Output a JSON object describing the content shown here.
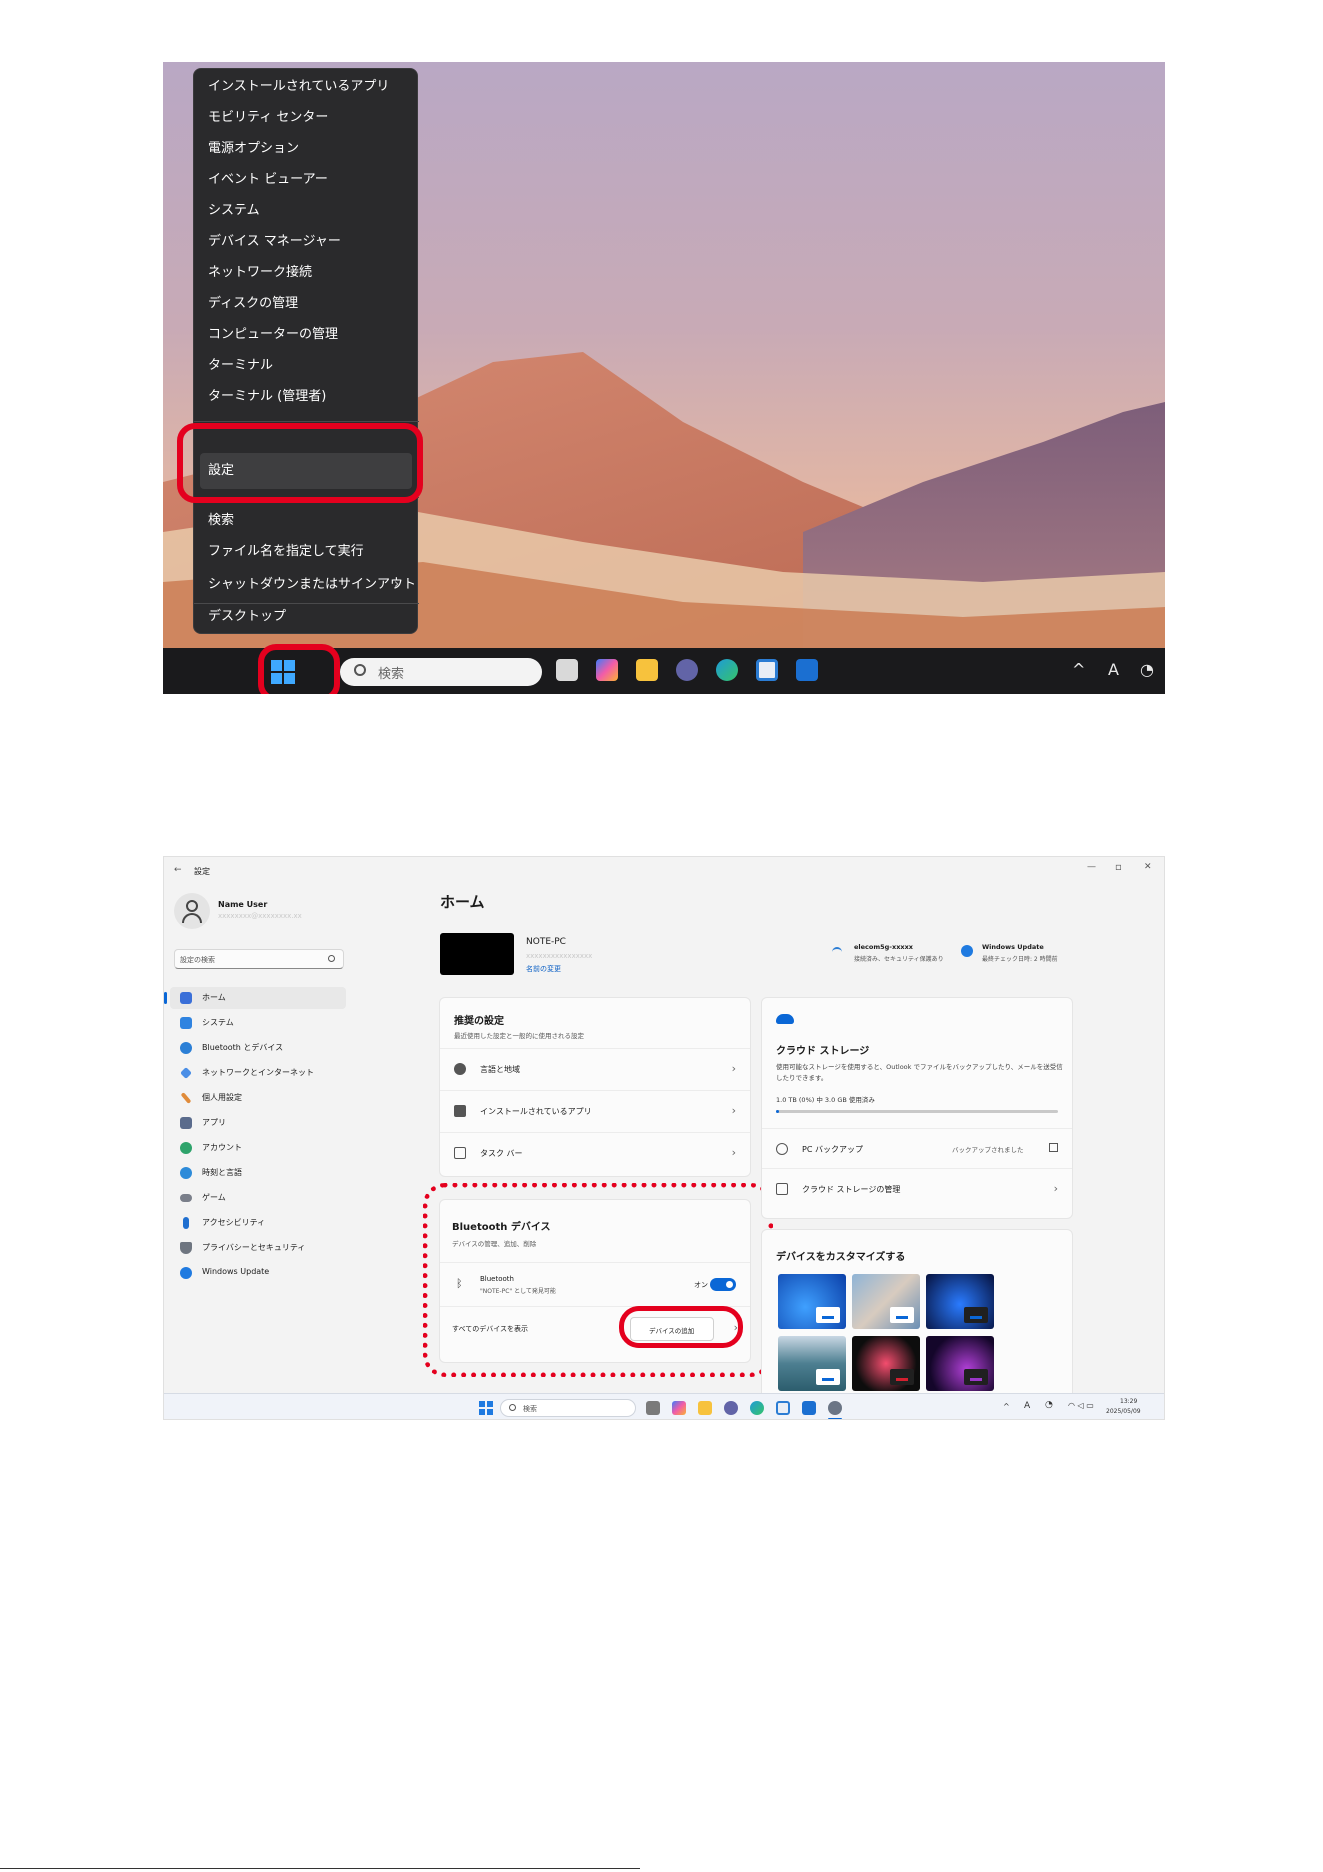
{
  "shot1": {
    "context_menu": {
      "items": [
        "インストールされているアプリ",
        "モビリティ センター",
        "電源オプション",
        "イベント ビューアー",
        "システム",
        "デバイス マネージャー",
        "ネットワーク接続",
        "ディスクの管理",
        "コンピューターの管理",
        "ターミナル",
        "ターミナル (管理者)",
        "設定",
        "検索",
        "ファイル名を指定して実行",
        "シャットダウンまたはサインアウト",
        "デスクトップ"
      ],
      "submenu_arrow": "›"
    },
    "taskbar": {
      "search_placeholder": "検索",
      "tray_up": "^",
      "tray_ime": "A",
      "tray_power": "◔"
    }
  },
  "shot2": {
    "window": {
      "back": "←",
      "title": "設定",
      "min": "—",
      "max": "▫",
      "close": "✕"
    },
    "user": {
      "name": "Name User",
      "email": "xxxxxxxx@xxxxxxxx.xx"
    },
    "search_placeholder": "設定の検索",
    "nav": [
      {
        "label": "ホーム",
        "color": "#3a6fd8"
      },
      {
        "label": "システム",
        "color": "#2f83e0"
      },
      {
        "label": "Bluetooth とデバイス",
        "color": "#2b7fd6"
      },
      {
        "label": "ネットワークとインターネット",
        "color": "#4a8ee6"
      },
      {
        "label": "個人用設定",
        "color": "#e08b3a"
      },
      {
        "label": "アプリ",
        "color": "#5a6b8c"
      },
      {
        "label": "アカウント",
        "color": "#2ea36b"
      },
      {
        "label": "時刻と言語",
        "color": "#2d8bd9"
      },
      {
        "label": "ゲーム",
        "color": "#7a7f8a"
      },
      {
        "label": "アクセシビリティ",
        "color": "#1f6fd0"
      },
      {
        "label": "プライバシーとセキュリティ",
        "color": "#6e7580"
      },
      {
        "label": "Windows Update",
        "color": "#1f7ae0"
      }
    ],
    "page_title": "ホーム",
    "device": {
      "name": "NOTE-PC",
      "model": "xxxxxxxxxxxxxxxx",
      "rename": "名前の変更"
    },
    "wifi": {
      "ssid": "elecom5g-xxxxx",
      "status": "接続済み、セキュリティ保護あり"
    },
    "update": {
      "title": "Windows Update",
      "status": "最終チェック日時: 2 時間前"
    },
    "recommended": {
      "title": "推奨の設定",
      "subtitle": "最近使用した設定と一般的に使用される設定",
      "rows": [
        "言語と地域",
        "インストールされているアプリ",
        "タスク バー"
      ]
    },
    "bluetooth": {
      "title": "Bluetooth デバイス",
      "subtitle": "デバイスの管理、追加、削除",
      "row_title": "Bluetooth",
      "row_sub": "\"NOTE-PC\" として発見可能",
      "toggle_label": "オン",
      "show_all": "すべてのデバイスを表示",
      "add_device": "デバイスの追加"
    },
    "cloud": {
      "title": "クラウド ストレージ",
      "desc": "使用可能なストレージを使用すると、Outlook でファイルをバックアップしたり、メールを送受信したりできます。",
      "usage": "1.0 TB (0%) 中 3.0 GB 使用済み",
      "usage_fraction": 0.003,
      "backup_label": "PC バックアップ",
      "backup_status": "バックアップされました",
      "manage": "クラウド ストレージの管理"
    },
    "customize": {
      "title": "デバイスをカスタマイズする"
    },
    "taskbar": {
      "search_placeholder": "検索",
      "time": "13:29",
      "date": "2025/05/09"
    }
  }
}
